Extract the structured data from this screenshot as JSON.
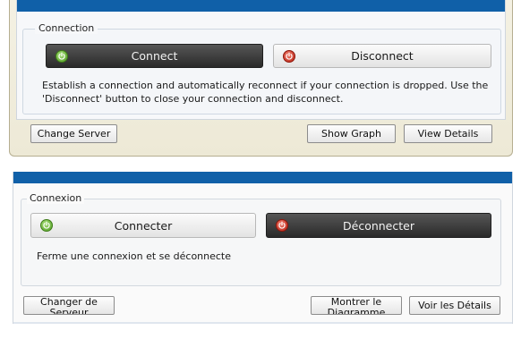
{
  "english_dialog": {
    "group_label": "Connection",
    "connect_label": "Connect",
    "disconnect_label": "Disconnect",
    "description_line1": "Establish a connection and automatically reconnect if your connection is dropped. Use the",
    "description_line2": "'Disconnect' button to close your connection and disconnect.",
    "change_server_label": "Change Server",
    "show_graph_label": "Show Graph",
    "view_details_label": "View Details"
  },
  "french_dialog": {
    "group_label": "Connexion",
    "connect_label": "Connecter",
    "disconnect_label": "Déconnecter",
    "description": "Ferme une connexion et se déconnecte",
    "change_server_line1": "Changer de",
    "change_server_line2": "Serveur",
    "show_graph_line1": "Montrer le",
    "show_graph_line2": "Diagramme",
    "view_details_label": "Voir les Détails"
  },
  "colors": {
    "title_bar": "#1060a8",
    "active_button": "#3a3a3a",
    "connect_icon": "#4f9c22",
    "disconnect_icon": "#b81f10"
  },
  "icons": {
    "connect": "power-on-icon",
    "disconnect": "power-off-icon"
  }
}
